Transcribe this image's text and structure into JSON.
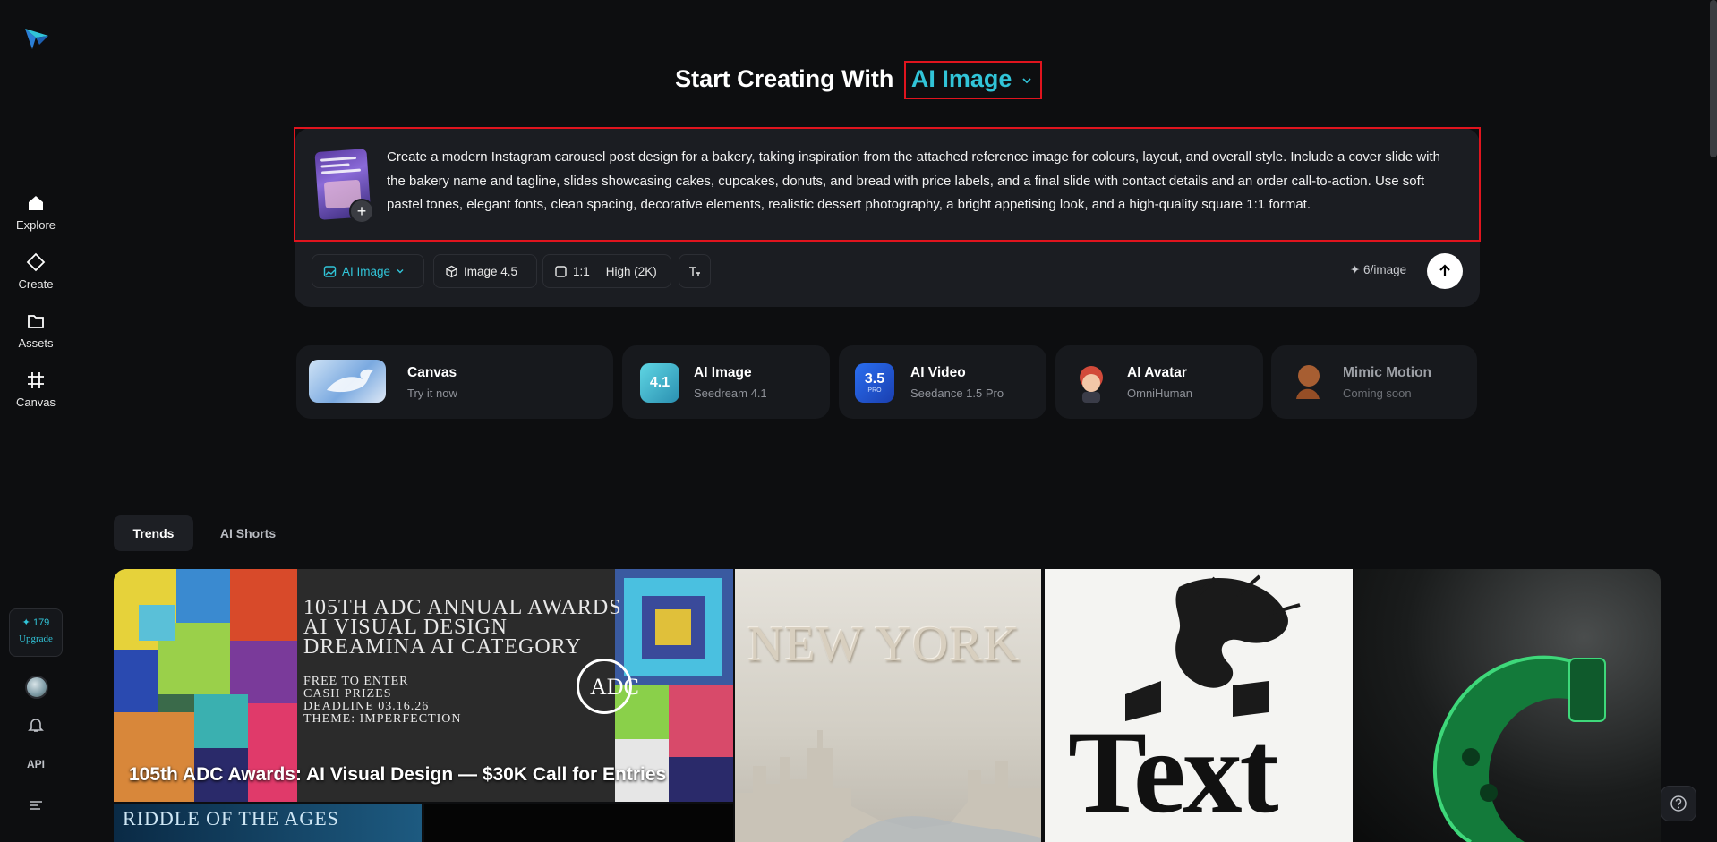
{
  "sidebar": {
    "logo": "paper-plane-logo",
    "items": [
      {
        "label": "Explore",
        "icon": "home-icon"
      },
      {
        "label": "Create",
        "icon": "diamond-icon"
      },
      {
        "label": "Assets",
        "icon": "folder-icon"
      },
      {
        "label": "Canvas",
        "icon": "canvas-icon"
      }
    ],
    "credits": "✦ 179",
    "upgrade_label": "Upgrade",
    "api_label": "API"
  },
  "heading": {
    "prefix": "Start Creating With",
    "selected_mode": "AI Image"
  },
  "prompt": {
    "text": "Create a modern Instagram carousel post design for a bakery, taking inspiration from the attached reference image for colours, layout, and overall style. Include a cover slide with the bakery name and tagline, slides showcasing cakes, cupcakes, donuts, and bread with price labels, and a final slide with contact details and an order call-to-action. Use soft pastel tones, elegant fonts, clean spacing, decorative elements, realistic dessert photography, a bright appetising look, and a high-quality square 1:1 format.",
    "add_label": "+"
  },
  "toolbar": {
    "mode": "AI Image",
    "model": "Image 4.5",
    "ratio": "1:1",
    "quality": "High (2K)",
    "cost": "✦ 6/image"
  },
  "cards": [
    {
      "title": "Canvas",
      "subtitle": "Try it now",
      "dim": false
    },
    {
      "title": "AI Image",
      "subtitle": "Seedream 4.1",
      "badge": "4.1",
      "dim": false
    },
    {
      "title": "AI Video",
      "subtitle": "Seedance 1.5 Pro",
      "badge": "3.5",
      "badge_sub": "PRO",
      "dim": false
    },
    {
      "title": "AI Avatar",
      "subtitle": "OmniHuman",
      "dim": false
    },
    {
      "title": "Mimic Motion",
      "subtitle": "Coming soon",
      "dim": true
    }
  ],
  "tabs": [
    {
      "label": "Trends",
      "active": true
    },
    {
      "label": "AI Shorts",
      "active": false
    }
  ],
  "gallery": {
    "featured": {
      "poster_lines": [
        "105TH ADC ANNUAL AWARDS",
        "AI VISUAL DESIGN",
        "DREAMINA AI CATEGORY"
      ],
      "poster_small": [
        "FREE TO ENTER",
        "CASH PRIZES",
        "DEADLINE 03.16.26",
        "THEME: IMPERFECTION"
      ],
      "logo": "ADC",
      "caption": "105th ADC Awards: AI Visual Design — $30K Call for Entries"
    },
    "tile2_text": "NEW YORK",
    "tile3_text": "Text",
    "tile5_text": "RIDDLE OF THE AGES"
  },
  "colors": {
    "accent": "#31c4d8",
    "highlight": "#e0141e",
    "background": "#0d0e10",
    "panel": "#1b1d22"
  }
}
